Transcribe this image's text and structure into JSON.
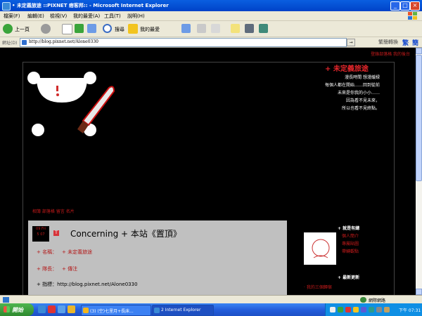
{
  "window": {
    "title": "• 未定義旅途 ::PIXNET 痞客邦:: - Microsoft Internet Explorer",
    "controls": {
      "minimize": "_",
      "maximize": "□",
      "close": "×"
    }
  },
  "menubar": {
    "items": [
      {
        "label": "檔案(F)"
      },
      {
        "label": "編輯(E)"
      },
      {
        "label": "檢視(V)"
      },
      {
        "label": "我的最愛(A)"
      },
      {
        "label": "工具(T)"
      },
      {
        "label": "說明(H)"
      }
    ]
  },
  "toolbar": {
    "back_label": "上一頁",
    "search_label": "搜尋",
    "favorites_label": "我的最愛"
  },
  "addressbar": {
    "label": "網址(D)",
    "url": "http://blog.pixnet.net/Alone0330",
    "go": "→",
    "translate_label": "繁簡轉換",
    "trad_label": "繁",
    "simp_label": "簡"
  },
  "page": {
    "toplinks": "登錄部落格   我的後台",
    "blog_title": "+ 未定義旅途",
    "poem": [
      "漫長時間 想漫緩緑",
      "每個人都在開始……回到從前",
      "未來是你我的小小……",
      "因為看不見未來，",
      "所以也看不見終點。"
    ],
    "navlinks": "相簿   部落格   留言   名片",
    "post": {
      "date_top": "09 Fri",
      "date_bottom": "5 07",
      "badge": "T",
      "title": "Concerning + 本站《置頂》",
      "line1_key": "+ 名稱：",
      "line1_val": "+ 未定義旅途",
      "line2_key": "+ 隊長：",
      "line2_val": "+ 傳注",
      "url_line": "+ 指標：http://blog.pixnet.net/Alone0330"
    },
    "sidebar": {
      "who_title": "+ 就是有總",
      "who_links": [
        "個人簡介",
        "專屬貼圖",
        "帶轉觀點"
      ],
      "latest_title": "+ 最新更新",
      "latest_item": "· 我的三個歸宿"
    }
  },
  "statusbar": {
    "zone": "網際網路"
  },
  "taskbar": {
    "start": "開始",
    "items": [
      {
        "label": "(3) (空)七里月+長床..."
      },
      {
        "label": "2 Internet Explorer"
      }
    ],
    "clock": "下午 07:31"
  }
}
